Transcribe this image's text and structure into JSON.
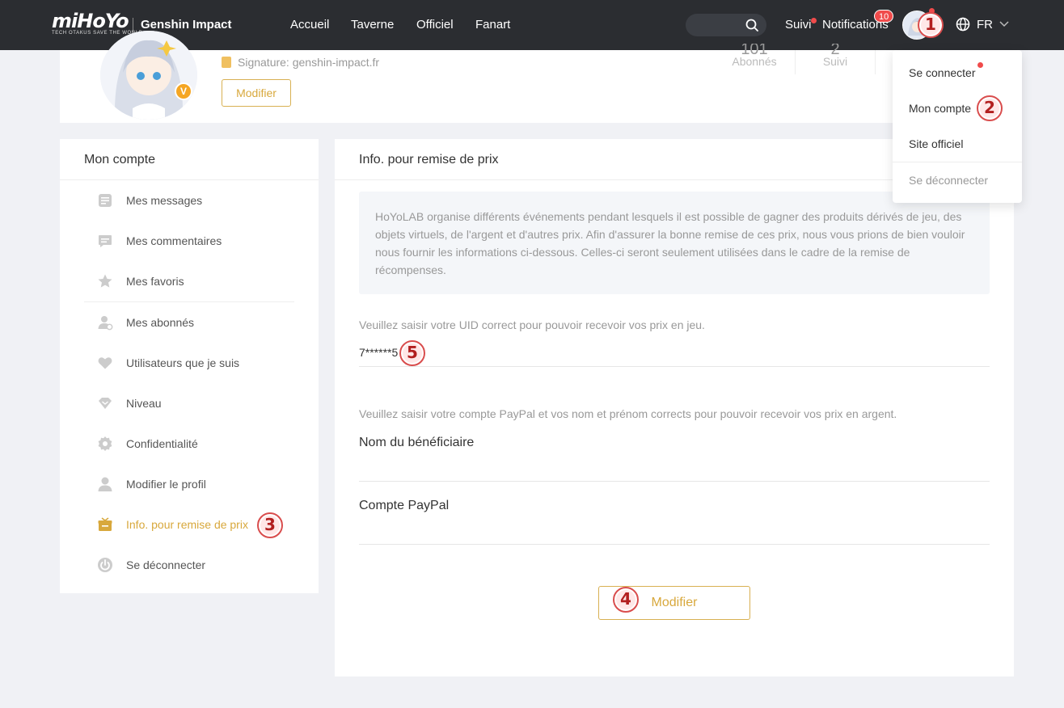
{
  "topbar": {
    "logo_main": "miHoYo",
    "logo_sub": "TECH OTAKUS SAVE THE WORLD",
    "brand": "Genshin Impact",
    "nav": [
      "Accueil",
      "Taverne",
      "Officiel",
      "Fanart"
    ],
    "suivi": "Suivi",
    "notifications": "Notifications",
    "notif_count": "10",
    "lang": "FR"
  },
  "markers": [
    "1",
    "2",
    "3",
    "4",
    "5"
  ],
  "profile": {
    "signature": "Signature: genshin-impact.fr",
    "modify_label": "Modifier",
    "v_badge": "V",
    "stats": [
      {
        "num": "101",
        "label": "Abonnés"
      },
      {
        "num": "2",
        "label": "Suivi"
      }
    ]
  },
  "sidebar": {
    "title": "Mon compte",
    "items": [
      {
        "label": "Mes messages",
        "icon": "message-icon"
      },
      {
        "label": "Mes commentaires",
        "icon": "comment-icon"
      },
      {
        "label": "Mes favoris",
        "icon": "star-icon"
      },
      {
        "label": "Mes abonnés",
        "icon": "followers-icon"
      },
      {
        "label": "Utilisateurs que je suis",
        "icon": "heart-icon"
      },
      {
        "label": "Niveau",
        "icon": "level-icon"
      },
      {
        "label": "Confidentialité",
        "icon": "gear-icon"
      },
      {
        "label": "Modifier le profil",
        "icon": "user-icon"
      },
      {
        "label": "Info. pour remise de prix",
        "icon": "gift-icon"
      },
      {
        "label": "Se déconnecter",
        "icon": "power-icon"
      }
    ]
  },
  "main": {
    "title": "Info. pour remise de prix",
    "info_text": "HoYoLAB organise différents événements pendant lesquels il est possible de gagner des produits dérivés de jeu, des objets virtuels, de l'argent et d'autres prix. Afin d'assurer la bonne remise de ces prix, nous vous prions de bien vouloir nous fournir les informations ci-dessous. Celles-ci seront seulement utilisées dans le cadre de la remise de récompenses.",
    "uid_hint": "Veuillez saisir votre UID correct pour pouvoir recevoir vos prix en jeu.",
    "uid_value": "7******5",
    "paypal_hint": "Veuillez saisir votre compte PayPal et vos nom et prénom corrects pour pouvoir recevoir vos prix en argent.",
    "beneficiary_label": "Nom du bénéficiaire",
    "paypal_label": "Compte PayPal",
    "modify_label": "Modifier"
  },
  "dropdown": {
    "items": [
      "Se connecter",
      "Mon compte",
      "Site officiel"
    ],
    "logout": "Se déconnecter"
  },
  "colors": {
    "accent": "#d8a83c",
    "topbar": "#2b2d31",
    "badge": "#f04b4b"
  }
}
